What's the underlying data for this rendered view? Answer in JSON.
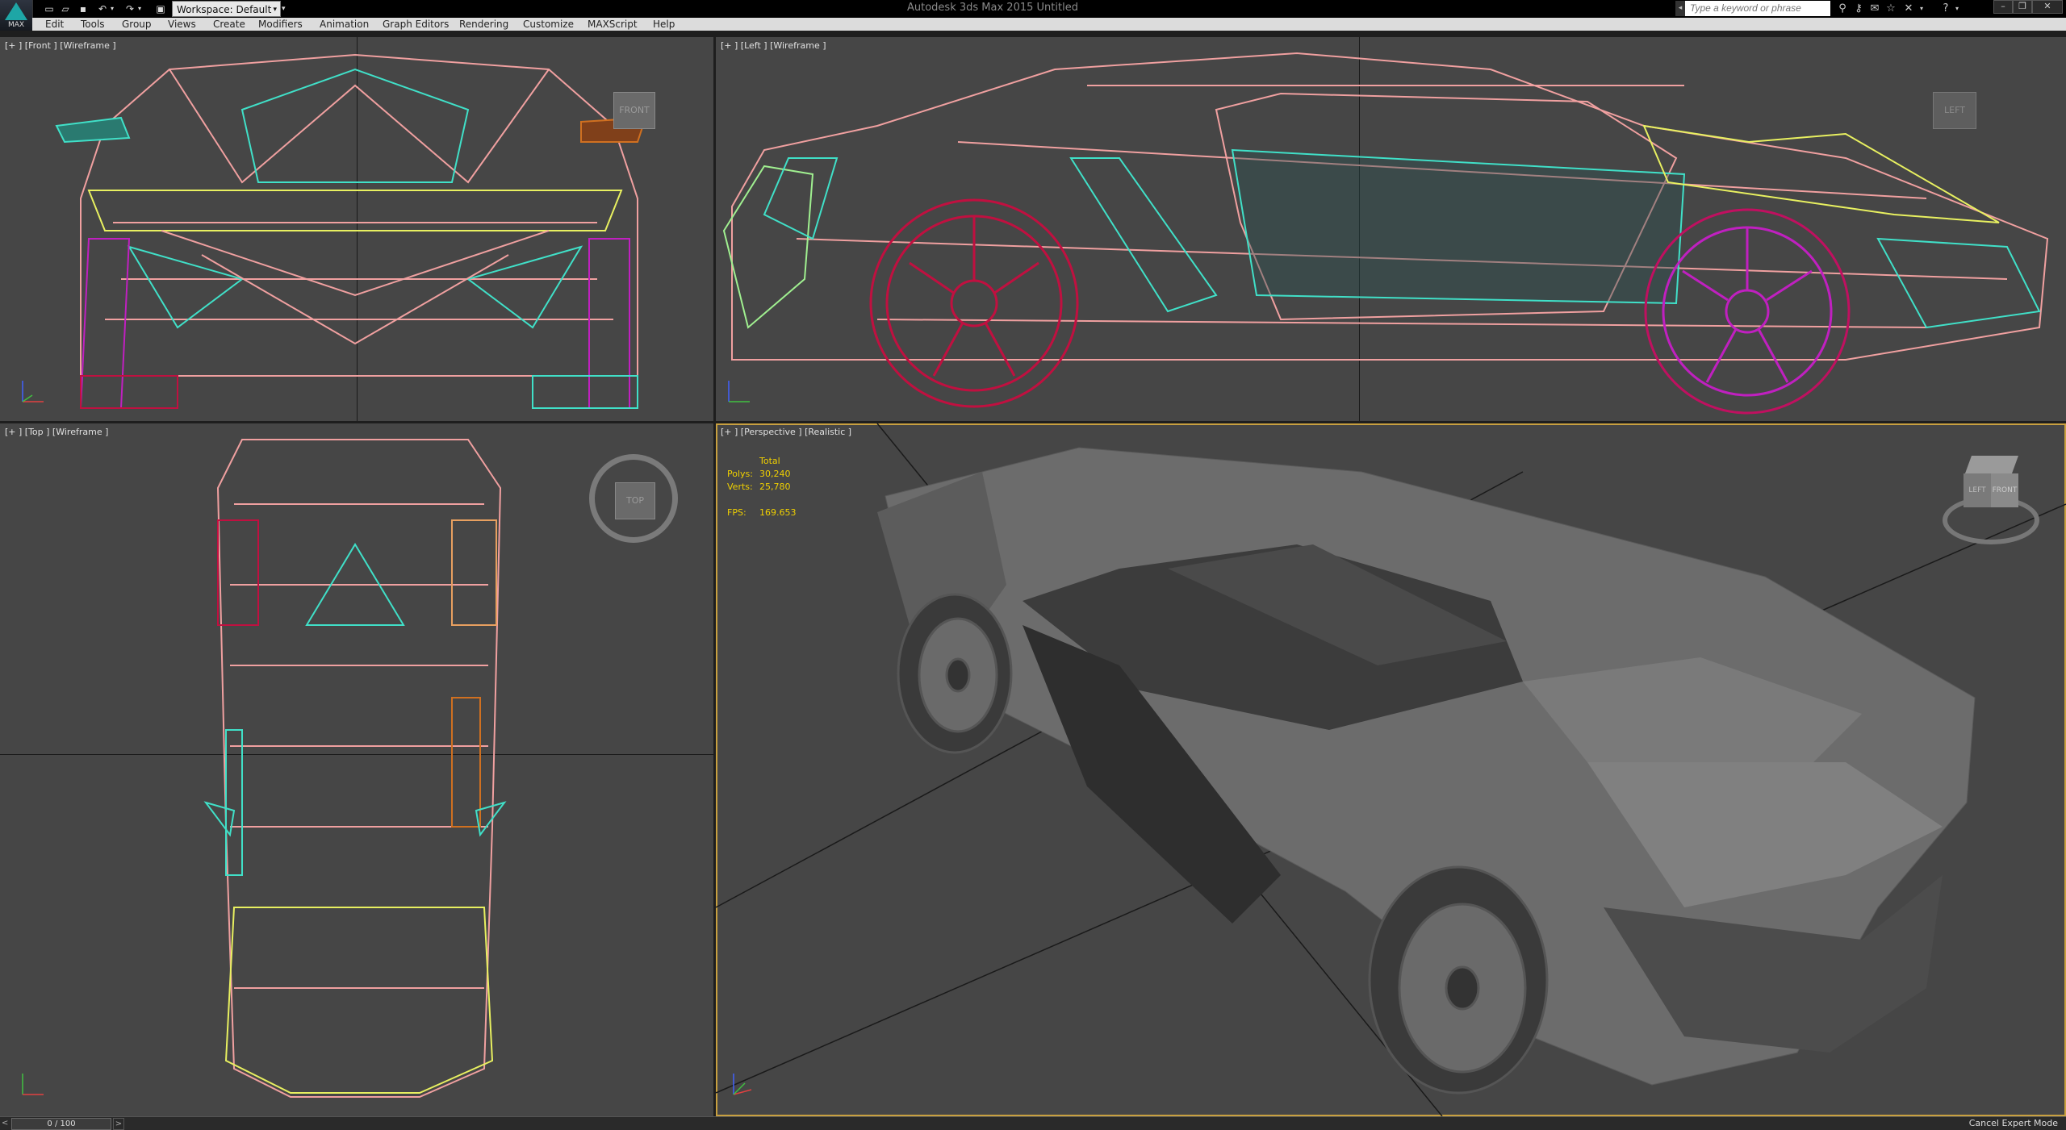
{
  "app": {
    "logo_label": "MAX",
    "window_title": "Autodesk 3ds Max 2015    Untitled"
  },
  "workspace": {
    "label": "Workspace: Default"
  },
  "search": {
    "placeholder": "Type a keyword or phrase"
  },
  "menu": [
    {
      "label": "Edit"
    },
    {
      "label": "Tools"
    },
    {
      "label": "Group"
    },
    {
      "label": "Views"
    },
    {
      "label": "Create"
    },
    {
      "label": "Modifiers"
    },
    {
      "label": "Animation"
    },
    {
      "label": "Graph Editors"
    },
    {
      "label": "Rendering"
    },
    {
      "label": "Customize"
    },
    {
      "label": "MAXScript"
    },
    {
      "label": "Help"
    }
  ],
  "viewports": {
    "front": {
      "label": "[+ ] [Front ] [Wireframe ]",
      "cube": "FRONT"
    },
    "left": {
      "label": "[+ ] [Left ] [Wireframe ]",
      "cube": "LEFT"
    },
    "top": {
      "label": "[+ ] [Top ] [Wireframe ]",
      "cube": "TOP"
    },
    "perspective": {
      "label": "[+ ] [Perspective ] [Realistic ]",
      "cube_left": "LEFT",
      "cube_front": "FRONT"
    }
  },
  "stats": {
    "total_label": "Total",
    "polys_label": "Polys:",
    "polys_value": "30,240",
    "verts_label": "Verts:",
    "verts_value": "25,780",
    "fps_label": "FPS:",
    "fps_value": "169.653"
  },
  "timeline": {
    "frame": "0 / 100"
  },
  "status": {
    "cancel_expert_mode": "Cancel Expert Mode"
  },
  "colors": {
    "pink": "#f0a0a0",
    "cyan": "#40e0c8",
    "yellow": "#e8f060",
    "magenta": "#c020c0",
    "crimson": "#c01040",
    "active_border": "#c8a040"
  }
}
